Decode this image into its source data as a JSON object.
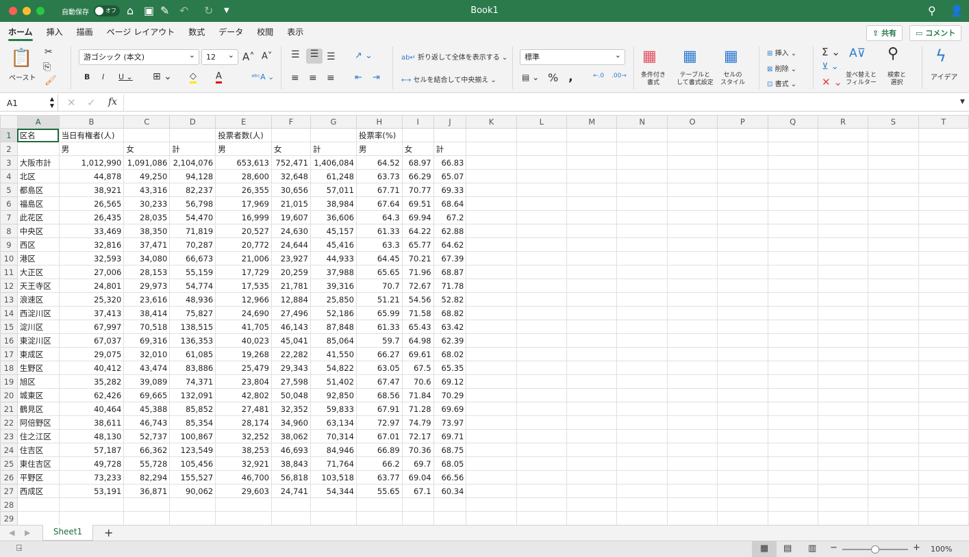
{
  "window": {
    "title": "Book1",
    "autosave_label": "自動保存",
    "autosave_state": "オフ"
  },
  "menu_tabs": [
    "ホーム",
    "挿入",
    "描画",
    "ページ レイアウト",
    "数式",
    "データ",
    "校閲",
    "表示"
  ],
  "top_buttons": {
    "share": "共有",
    "comment": "コメント"
  },
  "ribbon": {
    "paste": "ペースト",
    "font_name": "游ゴシック (本文)",
    "font_size": "12",
    "wrap_text": "折り返して全体を表示する",
    "merge_center": "セルを結合して中央揃え",
    "number_format": "標準",
    "conditional_format": [
      "条件付き",
      "書式"
    ],
    "format_table": [
      "テーブルと",
      "して書式設定"
    ],
    "cell_styles": [
      "セルの",
      "スタイル"
    ],
    "insert": "挿入",
    "delete": "削除",
    "format": "書式",
    "sort_filter": [
      "並べ替えと",
      "フィルター"
    ],
    "find_select": [
      "検索と",
      "選択"
    ],
    "ideas": "アイデア",
    "highlight_color": "#ffe600",
    "font_color": "#e00000"
  },
  "formula_bar": {
    "name_box": "A1",
    "formula": ""
  },
  "columns": [
    "A",
    "B",
    "C",
    "D",
    "E",
    "F",
    "G",
    "H",
    "I",
    "J",
    "K",
    "L",
    "M",
    "N",
    "O",
    "P",
    "Q",
    "R",
    "S",
    "T"
  ],
  "rows": [
    [
      "区名",
      "当日有権者(人)",
      "",
      "",
      "投票者数(人)",
      "",
      "",
      "投票率(%)",
      "",
      ""
    ],
    [
      "",
      "男",
      "女",
      "計",
      "男",
      "女",
      "計",
      "男",
      "女",
      "計"
    ],
    [
      "大阪市計",
      "1,012,990",
      "1,091,086",
      "2,104,076",
      "653,613",
      "752,471",
      "1,406,084",
      "64.52",
      "68.97",
      "66.83"
    ],
    [
      "北区",
      "44,878",
      "49,250",
      "94,128",
      "28,600",
      "32,648",
      "61,248",
      "63.73",
      "66.29",
      "65.07"
    ],
    [
      "都島区",
      "38,921",
      "43,316",
      "82,237",
      "26,355",
      "30,656",
      "57,011",
      "67.71",
      "70.77",
      "69.33"
    ],
    [
      "福島区",
      "26,565",
      "30,233",
      "56,798",
      "17,969",
      "21,015",
      "38,984",
      "67.64",
      "69.51",
      "68.64"
    ],
    [
      "此花区",
      "26,435",
      "28,035",
      "54,470",
      "16,999",
      "19,607",
      "36,606",
      "64.3",
      "69.94",
      "67.2"
    ],
    [
      "中央区",
      "33,469",
      "38,350",
      "71,819",
      "20,527",
      "24,630",
      "45,157",
      "61.33",
      "64.22",
      "62.88"
    ],
    [
      "西区",
      "32,816",
      "37,471",
      "70,287",
      "20,772",
      "24,644",
      "45,416",
      "63.3",
      "65.77",
      "64.62"
    ],
    [
      "港区",
      "32,593",
      "34,080",
      "66,673",
      "21,006",
      "23,927",
      "44,933",
      "64.45",
      "70.21",
      "67.39"
    ],
    [
      "大正区",
      "27,006",
      "28,153",
      "55,159",
      "17,729",
      "20,259",
      "37,988",
      "65.65",
      "71.96",
      "68.87"
    ],
    [
      "天王寺区",
      "24,801",
      "29,973",
      "54,774",
      "17,535",
      "21,781",
      "39,316",
      "70.7",
      "72.67",
      "71.78"
    ],
    [
      "浪速区",
      "25,320",
      "23,616",
      "48,936",
      "12,966",
      "12,884",
      "25,850",
      "51.21",
      "54.56",
      "52.82"
    ],
    [
      "西淀川区",
      "37,413",
      "38,414",
      "75,827",
      "24,690",
      "27,496",
      "52,186",
      "65.99",
      "71.58",
      "68.82"
    ],
    [
      "淀川区",
      "67,997",
      "70,518",
      "138,515",
      "41,705",
      "46,143",
      "87,848",
      "61.33",
      "65.43",
      "63.42"
    ],
    [
      "東淀川区",
      "67,037",
      "69,316",
      "136,353",
      "40,023",
      "45,041",
      "85,064",
      "59.7",
      "64.98",
      "62.39"
    ],
    [
      "東成区",
      "29,075",
      "32,010",
      "61,085",
      "19,268",
      "22,282",
      "41,550",
      "66.27",
      "69.61",
      "68.02"
    ],
    [
      "生野区",
      "40,412",
      "43,474",
      "83,886",
      "25,479",
      "29,343",
      "54,822",
      "63.05",
      "67.5",
      "65.35"
    ],
    [
      "旭区",
      "35,282",
      "39,089",
      "74,371",
      "23,804",
      "27,598",
      "51,402",
      "67.47",
      "70.6",
      "69.12"
    ],
    [
      "城東区",
      "62,426",
      "69,665",
      "132,091",
      "42,802",
      "50,048",
      "92,850",
      "68.56",
      "71.84",
      "70.29"
    ],
    [
      "鶴見区",
      "40,464",
      "45,388",
      "85,852",
      "27,481",
      "32,352",
      "59,833",
      "67.91",
      "71.28",
      "69.69"
    ],
    [
      "阿倍野区",
      "38,611",
      "46,743",
      "85,354",
      "28,174",
      "34,960",
      "63,134",
      "72.97",
      "74.79",
      "73.97"
    ],
    [
      "住之江区",
      "48,130",
      "52,737",
      "100,867",
      "32,252",
      "38,062",
      "70,314",
      "67.01",
      "72.17",
      "69.71"
    ],
    [
      "住吉区",
      "57,187",
      "66,362",
      "123,549",
      "38,253",
      "46,693",
      "84,946",
      "66.89",
      "70.36",
      "68.75"
    ],
    [
      "東住吉区",
      "49,728",
      "55,728",
      "105,456",
      "32,921",
      "38,843",
      "71,764",
      "66.2",
      "69.7",
      "68.05"
    ],
    [
      "平野区",
      "73,233",
      "82,294",
      "155,527",
      "46,700",
      "56,818",
      "103,518",
      "63.77",
      "69.04",
      "66.56"
    ],
    [
      "西成区",
      "53,191",
      "36,871",
      "90,062",
      "29,603",
      "24,741",
      "54,344",
      "55.65",
      "67.1",
      "60.34"
    ],
    [
      "",
      "",
      "",
      "",
      "",
      "",
      "",
      "",
      "",
      ""
    ],
    [
      "",
      "",
      "",
      "",
      "",
      "",
      "",
      "",
      "",
      ""
    ]
  ],
  "sheets": [
    "Sheet1"
  ],
  "status": {
    "zoom": "100%",
    "zoom_level": 100
  },
  "colors": {
    "brand": "#2a7a4b",
    "selection": "#1d6b3f"
  }
}
